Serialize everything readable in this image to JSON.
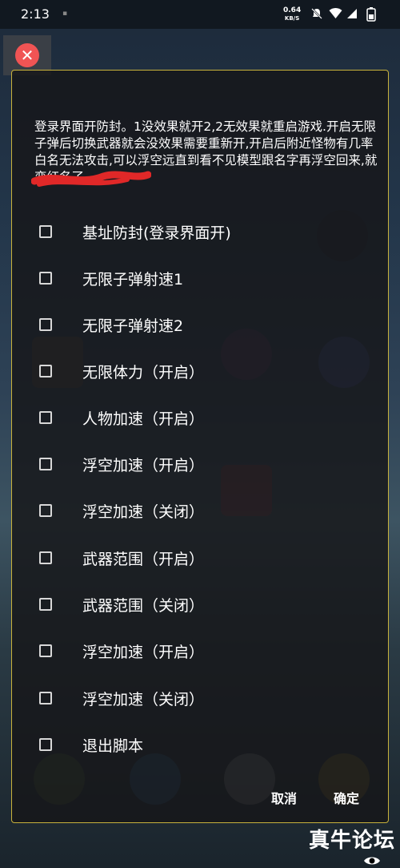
{
  "status_bar": {
    "time": "2:13",
    "net_speed_value": "0.64",
    "net_speed_unit": "KB/S",
    "icons": [
      "silent-bell-icon",
      "wifi-icon",
      "cell-signal-icon",
      "battery-icon"
    ]
  },
  "dialog": {
    "description": "登录界面开防封。1没效果就开2,2无效果就重启游戏.开启无限子弹后切换武器就会没效果需要重新开,开启后附近怪物有几率白名无法攻击,可以浮空远直到看不见模型跟名字再浮空回来,就变红名了。",
    "options": [
      {
        "label": "基址防封(登录界面开)",
        "checked": false
      },
      {
        "label": "无限子弹射速1",
        "checked": false
      },
      {
        "label": "无限子弹射速2",
        "checked": false
      },
      {
        "label": "无限体力（开启）",
        "checked": false
      },
      {
        "label": "人物加速（开启）",
        "checked": false
      },
      {
        "label": "浮空加速（开启）",
        "checked": false
      },
      {
        "label": "浮空加速（关闭）",
        "checked": false
      },
      {
        "label": "武器范围（开启）",
        "checked": false
      },
      {
        "label": "武器范围（关闭）",
        "checked": false
      },
      {
        "label": "浮空加速（开启）",
        "checked": false
      },
      {
        "label": "浮空加速（关闭）",
        "checked": false
      },
      {
        "label": "退出脚本",
        "checked": false
      }
    ],
    "cancel_label": "取消",
    "confirm_label": "确定"
  },
  "watermark": "真牛论坛",
  "colors": {
    "dialog_border": "#c8b23c",
    "close_red": "#f05454"
  }
}
